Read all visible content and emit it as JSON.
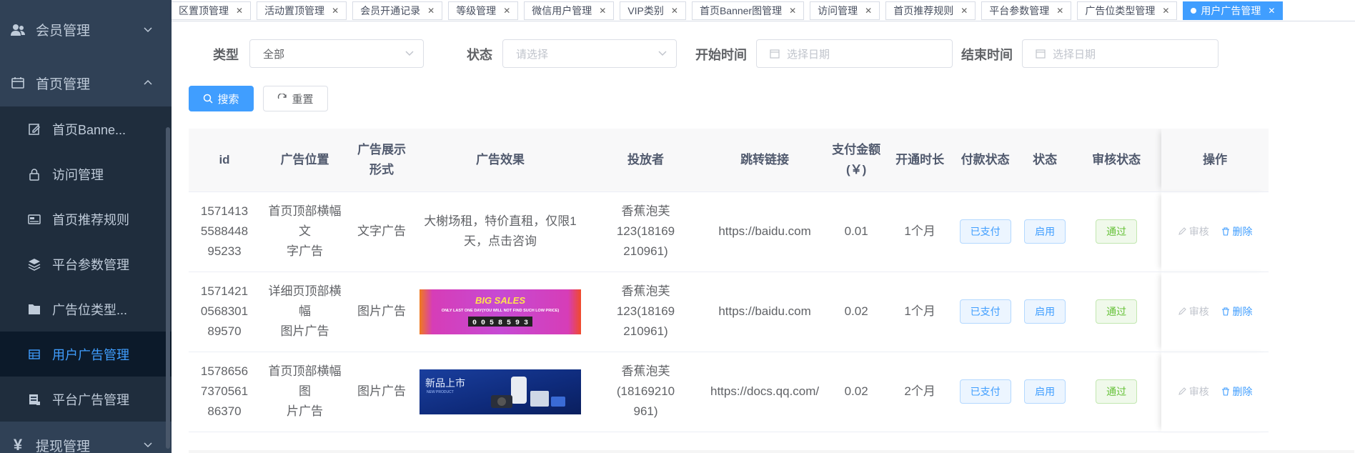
{
  "sidebar": {
    "groups": [
      {
        "label": "会员管理",
        "icon": "users-icon",
        "expanded": false
      },
      {
        "label": "首页管理",
        "icon": "calendar-icon",
        "expanded": true
      },
      {
        "label": "提现管理",
        "icon": "yen-icon",
        "expanded": false
      }
    ],
    "items": [
      {
        "label": "首页Banne...",
        "icon": "edit-icon"
      },
      {
        "label": "访问管理",
        "icon": "lock-icon"
      },
      {
        "label": "首页推荐规则",
        "icon": "card-icon"
      },
      {
        "label": "平台参数管理",
        "icon": "layers-icon"
      },
      {
        "label": "广告位类型...",
        "icon": "folder-icon"
      },
      {
        "label": "用户广告管理",
        "icon": "table-icon",
        "active": true
      },
      {
        "label": "平台广告管理",
        "icon": "server-icon"
      }
    ]
  },
  "tags": [
    {
      "label": "区置顶管理"
    },
    {
      "label": "活动置顶管理"
    },
    {
      "label": "会员开通记录"
    },
    {
      "label": "等级管理"
    },
    {
      "label": "微信用户管理"
    },
    {
      "label": "VIP类别"
    },
    {
      "label": "首页Banner图管理"
    },
    {
      "label": "访问管理"
    },
    {
      "label": "首页推荐规则"
    },
    {
      "label": "平台参数管理"
    },
    {
      "label": "广告位类型管理"
    },
    {
      "label": "用户广告管理",
      "active": true
    }
  ],
  "filters": {
    "type_label": "类型",
    "type_value": "全部",
    "status_label": "状态",
    "status_placeholder": "请选择",
    "start_label": "开始时间",
    "start_placeholder": "选择日期",
    "end_label": "结束时间",
    "end_placeholder": "选择日期",
    "search_button": "搜索",
    "reset_button": "重置"
  },
  "table": {
    "headers": {
      "id": "id",
      "position": "广告位置",
      "display_a": "广告展示",
      "display_b": "形式",
      "effect": "广告效果",
      "publisher": "投放者",
      "link": "跳转链接",
      "amount_a": "支付金额",
      "amount_b": "(￥)",
      "duration": "开通时长",
      "pay_status": "付款状态",
      "status": "状态",
      "audit": "审核状态",
      "ops": "操作"
    },
    "rows": [
      {
        "id_a": "1571413",
        "id_b": "5588448",
        "id_c": "95233",
        "pos_a": "首页顶部横幅文",
        "pos_b": "字广告",
        "display": "文字广告",
        "effect_type": "text",
        "effect_a": "大榭场租，特价直租，仅限1",
        "effect_b": "天，点击咨询",
        "pub_a": "香蕉泡芙123(18169",
        "pub_b": "210961)",
        "link": "https://baidu.com",
        "amount": "0.01",
        "duration": "1个月",
        "pay": "已支付",
        "status": "启用",
        "audit": "通过",
        "op_audit": "审核",
        "op_delete": "删除"
      },
      {
        "id_a": "1571421",
        "id_b": "0568301",
        "id_c": "89570",
        "pos_a": "详细页顶部横幅",
        "pos_b": "图片广告",
        "display": "图片广告",
        "effect_type": "image-sales",
        "effect_img_text": "BIG SALES",
        "effect_img_sub": "ONLY LAST ONE DAY(YOU WILL NOT FIND SUCH LOW PRICE)",
        "effect_img_digits": "0 0 5 8 5 9 3",
        "pub_a": "香蕉泡芙123(18169",
        "pub_b": "210961)",
        "link": "https://baidu.com",
        "amount": "0.02",
        "duration": "1个月",
        "pay": "已支付",
        "status": "启用",
        "audit": "通过",
        "op_audit": "审核",
        "op_delete": "删除"
      },
      {
        "id_a": "1578656",
        "id_b": "7370561",
        "id_c": "86370",
        "pos_a": "首页顶部横幅图",
        "pos_b": "片广告",
        "display": "图片广告",
        "effect_type": "image-newproduct",
        "effect_img_text": "新品上市",
        "effect_img_sub": "NEW PRODUCT",
        "pub_a": "香蕉泡芙(18169210",
        "pub_b": "961)",
        "link": "https://docs.qq.com/",
        "amount": "0.02",
        "duration": "2个月",
        "pay": "已支付",
        "status": "启用",
        "audit": "通过",
        "op_audit": "审核",
        "op_delete": "删除"
      }
    ]
  },
  "colors": {
    "sidebar_bg": "#304156",
    "accent": "#409eff",
    "success": "#67c23a"
  }
}
